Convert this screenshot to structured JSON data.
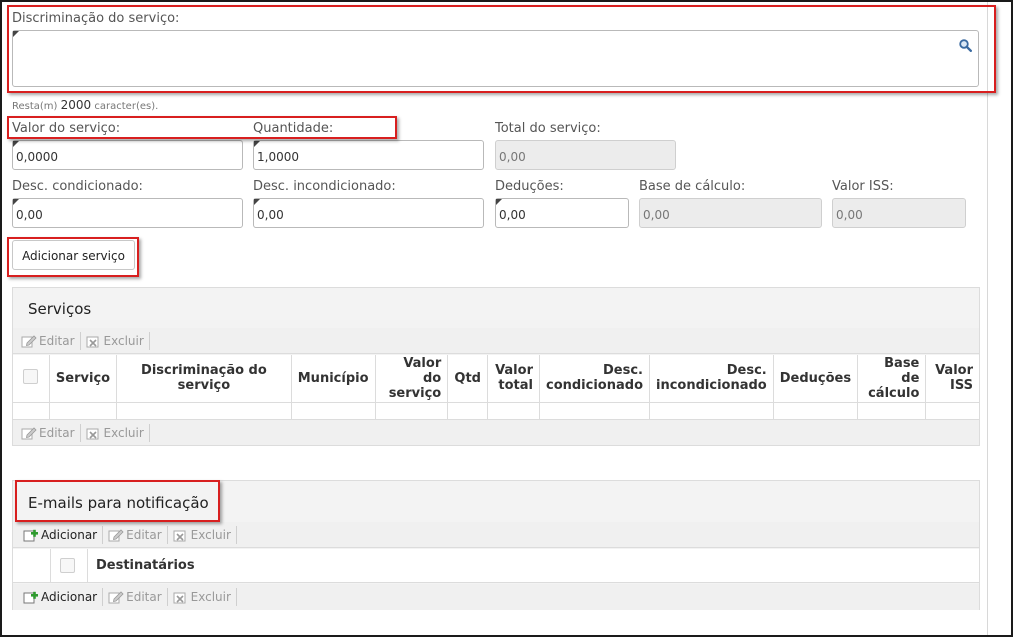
{
  "form": {
    "discriminacao_label": "Discriminação do serviço:",
    "resta_prefix": "Resta(m)",
    "resta_count": "2000",
    "resta_suffix": "caracter(es).",
    "valor_servico_label": "Valor do serviço:",
    "valor_servico_value": "0,0000",
    "quantidade_label": "Quantidade:",
    "quantidade_value": "1,0000",
    "total_label": "Total do serviço:",
    "total_value": "0,00",
    "desc_cond_label": "Desc. condicionado:",
    "desc_cond_value": "0,00",
    "desc_incond_label": "Desc. incondicionado:",
    "desc_incond_value": "0,00",
    "deducoes_label": "Deduções:",
    "deducoes_value": "0,00",
    "base_calculo_label": "Base de cálculo:",
    "base_calculo_value": "0,00",
    "valor_iss_label": "Valor ISS:",
    "valor_iss_value": "0,00",
    "adicionar_servico_label": "Adicionar serviço"
  },
  "servicos": {
    "title": "Serviços",
    "editar": "Editar",
    "excluir": "Excluir",
    "col_servico": "Serviço",
    "col_discriminacao": "Discriminação do serviço",
    "col_municipio": "Município",
    "col_valor_l1": "Valor do",
    "col_valor_l2": "serviço",
    "col_qtd": "Qtd",
    "col_total_l1": "Valor",
    "col_total_l2": "total",
    "col_desc_cond_l1": "Desc.",
    "col_desc_cond_l2": "condicionado",
    "col_desc_incond_l1": "Desc.",
    "col_desc_incond_l2": "incondicionado",
    "col_deducoes": "Deduções",
    "col_base_l1": "Base de",
    "col_base_l2": "cálculo",
    "col_iss_l1": "Valor",
    "col_iss_l2": "ISS"
  },
  "emails": {
    "title": "E-mails para notificação",
    "adicionar": "Adicionar",
    "editar": "Editar",
    "excluir": "Excluir",
    "col_destinatarios": "Destinatários"
  },
  "colors": {
    "highlight": "#d81f1f",
    "border": "#b9b9b9",
    "readonly_bg": "#ececec"
  }
}
